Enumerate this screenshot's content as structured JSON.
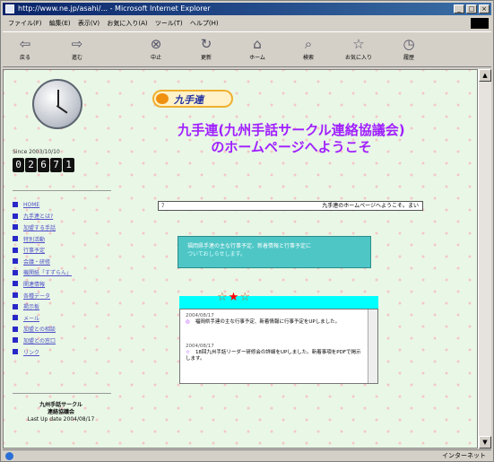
{
  "window": {
    "title": "http://www.ne.jp/asahi/... - Microsoft Internet Explorer",
    "controls": [
      "_",
      "□",
      "×"
    ]
  },
  "menubar": [
    "ファイル(F)",
    "編集(E)",
    "表示(V)",
    "お気に入り(A)",
    "ツール(T)",
    "ヘルプ(H)"
  ],
  "toolbar": {
    "back": "戻る",
    "forward": "進む",
    "stop": "中止",
    "refresh": "更新",
    "home": "ホーム",
    "search": "検索",
    "favorites": "お気に入り",
    "history": "履歴"
  },
  "sidebar": {
    "since": "Since 2003/10/10",
    "counter": [
      "0",
      "2",
      "6",
      "7",
      "1"
    ],
    "nav": [
      "HOME",
      "九手連とは?",
      "加盟する手話",
      "特別活動",
      "行事予定",
      "会議・研修",
      "機関紙「すずらん」",
      "関連情報",
      "各種データ",
      "掲示板",
      "メール",
      "加盟との相談",
      "加盟との窓口",
      "リンク"
    ],
    "footer": {
      "org_line1": "九州手話サークル",
      "org_line2": "連絡協議会",
      "last_update": "Last Up date 2004/08/17"
    }
  },
  "main": {
    "logo_text": "九手連",
    "welcome_line1": "九手連(九州手話サークル連絡協議会)",
    "welcome_line2": "のホームページへようこそ",
    "marquee_left": "ﾌ",
    "marquee_right": "九手連のホームページへようこそ。まい",
    "notice_line1": "福岡県手連の主な行事予定、新着情報と行事予定に",
    "notice_line2": "ついておしらせします。",
    "news": {
      "star_left": "☆",
      "star_mid": "★",
      "star_right": "☆",
      "item1_date": "2004/08/17",
      "item1_text": "福岡県手連の主な行事予定、新着情報に行事予定をUPしました。",
      "item2_date": "2004/08/17",
      "item2_text": "18回九州手話リーダー研修会の詳細をUPしました。新着事項をPDFで掲示します。"
    }
  },
  "statusbar": {
    "left": "",
    "zone": "インターネット"
  },
  "colors": {
    "page_bg": "#e9f7e6",
    "welcome_text": "#a020ff",
    "nav_link": "#5050c8",
    "nav_bullet": "#2828c8",
    "news_header": "#00ffff",
    "notice_box": "#4fc6c6"
  }
}
